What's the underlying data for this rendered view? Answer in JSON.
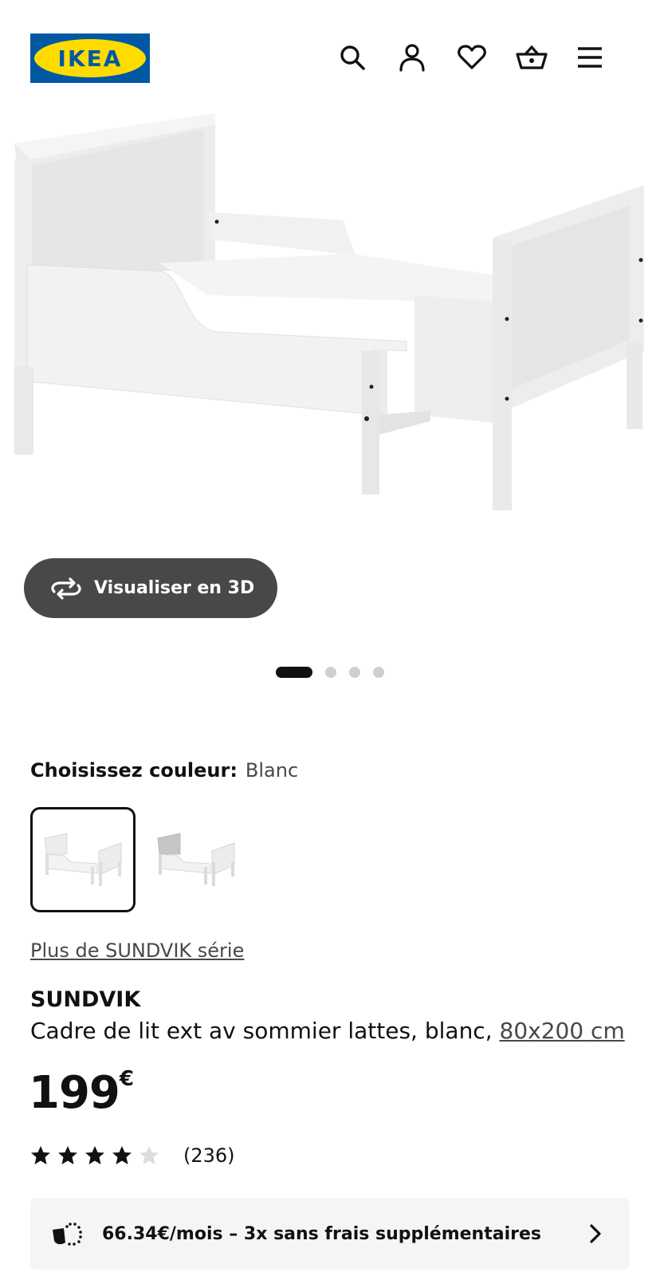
{
  "brand": {
    "name": "IKEA",
    "blue": "#0058a3",
    "yellow": "#ffdb00"
  },
  "header": {
    "icons": [
      "search-icon",
      "account-icon",
      "heart-icon",
      "basket-icon",
      "menu-icon"
    ]
  },
  "gallery": {
    "view3d_label": "Visualiser en 3D",
    "total_images": 4,
    "active_index": 0
  },
  "color_chooser": {
    "label": "Choisissez couleur:",
    "selected": "Blanc"
  },
  "series_link": "Plus de SUNDVIK série",
  "product": {
    "name": "SUNDVIK",
    "description": "Cadre de lit ext av sommier lattes, blanc, ",
    "size_link": "80x200 cm",
    "price": "199",
    "currency": "€",
    "rating_value": 4,
    "rating_max": 5,
    "review_count": "(236)"
  },
  "financing": {
    "text": "66.34€/mois – 3x sans frais supplémentaires"
  }
}
